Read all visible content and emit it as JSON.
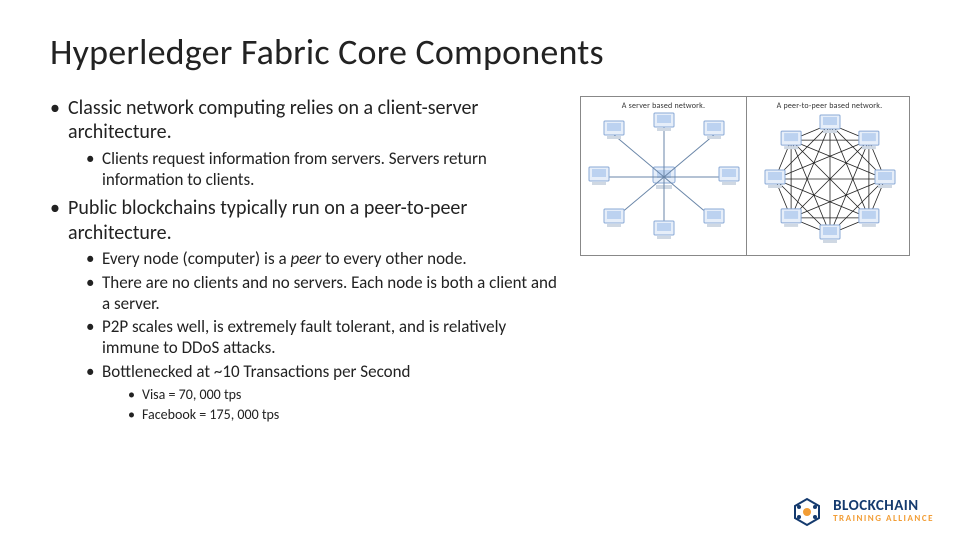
{
  "title": "Hyperledger Fabric Core Components",
  "bullets": {
    "b1": "Classic network computing relies on a client-server architecture.",
    "b1_1": "Clients request information from servers. Servers return information to clients.",
    "b2": "Public blockchains typically run on a peer-to-peer architecture.",
    "b2_1_pre": "Every node (computer) is a ",
    "b2_1_em": "peer",
    "b2_1_post": " to every other node.",
    "b2_2": "There are no clients and no servers. Each node is both a client and a server.",
    "b2_3": "P2P scales well, is extremely fault tolerant, and is relatively immune to DDoS attacks.",
    "b2_4": "Bottlenecked at ~10 Transactions per Second",
    "b2_4_1": "Visa = 70, 000 tps",
    "b2_4_2": "Facebook = 175, 000 tps"
  },
  "diagram": {
    "left_title": "A server based network.",
    "right_title": "A peer-to-peer based network."
  },
  "logo": {
    "line1": "BLOCKCHAIN",
    "line2": "TRAINING ALLIANCE"
  }
}
